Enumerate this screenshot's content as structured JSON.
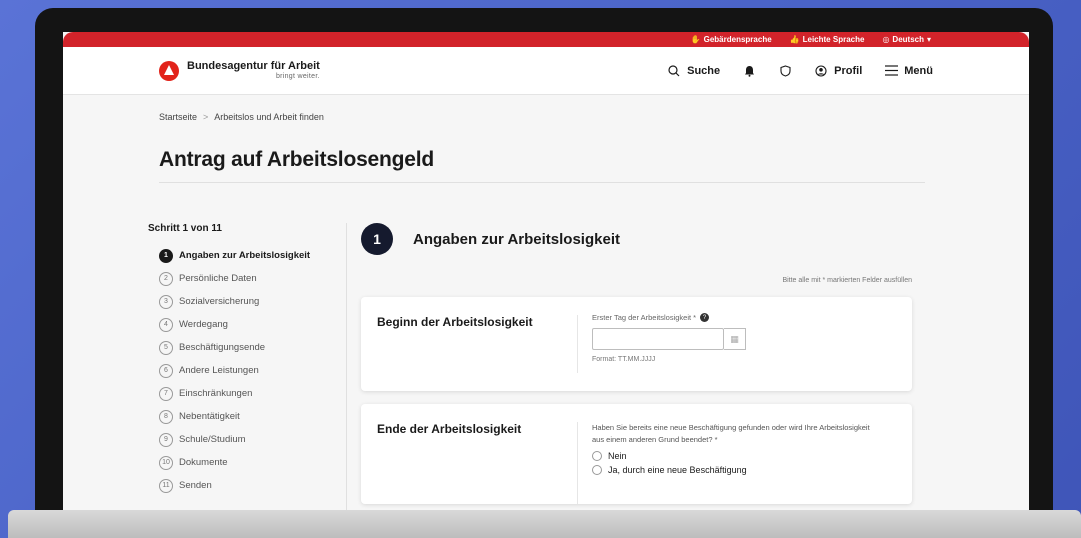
{
  "topbar": {
    "sign_language": "Gebärdensprache",
    "easy_language": "Leichte Sprache",
    "language": "Deutsch"
  },
  "header": {
    "org_name": "Bundesagentur für Arbeit",
    "claim": "bringt weiter.",
    "search_label": "Suche",
    "profile_label": "Profil",
    "menu_label": "Menü"
  },
  "breadcrumb": {
    "home": "Startseite",
    "separator": ">",
    "current": "Arbeitslos und Arbeit finden"
  },
  "page_title": "Antrag auf Arbeitslosengeld",
  "steps": {
    "count_label": "Schritt 1 von 11",
    "items": [
      {
        "num": "1",
        "label": "Angaben zur Arbeitslosigkeit"
      },
      {
        "num": "2",
        "label": "Persönliche Daten"
      },
      {
        "num": "3",
        "label": "Sozialversicherung"
      },
      {
        "num": "4",
        "label": "Werdegang"
      },
      {
        "num": "5",
        "label": "Beschäftigungsende"
      },
      {
        "num": "6",
        "label": "Andere Leistungen"
      },
      {
        "num": "7",
        "label": "Einschränkungen"
      },
      {
        "num": "8",
        "label": "Nebentätigkeit"
      },
      {
        "num": "9",
        "label": "Schule/Studium"
      },
      {
        "num": "10",
        "label": "Dokumente"
      },
      {
        "num": "11",
        "label": "Senden"
      }
    ]
  },
  "form": {
    "step_number": "1",
    "title": "Angaben zur Arbeitslosigkeit",
    "required_hint": "Bitte alle mit * markierten Felder ausfüllen",
    "section_start": {
      "title": "Beginn der Arbeitslosigkeit",
      "field_label": "Erster Tag der Arbeitslosigkeit *",
      "value": "",
      "format_hint": "Format: TT.MM.JJJJ"
    },
    "section_end": {
      "title": "Ende der Arbeitslosigkeit",
      "question": "Haben Sie bereits eine neue Beschäftigung gefunden oder wird Ihre Arbeitslosigkeit aus einem anderen Grund beendet? *",
      "options": [
        "Nein",
        "Ja, durch eine neue Beschäftigung"
      ]
    }
  },
  "colors": {
    "brand_red": "#d2232a",
    "step_active": "#151a2e"
  }
}
